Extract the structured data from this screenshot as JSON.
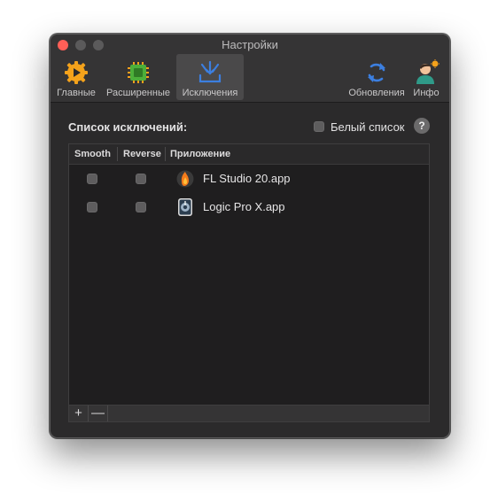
{
  "window": {
    "title": "Настройки"
  },
  "toolbar": {
    "tabs": [
      {
        "label": "Главные",
        "icon": "gear-play-icon"
      },
      {
        "label": "Расширенные",
        "icon": "chip-icon"
      },
      {
        "label": "Исключения",
        "icon": "arrows-in-tray-icon",
        "active": true
      },
      {
        "label": "Обновления",
        "icon": "refresh-icon"
      },
      {
        "label": "Инфо",
        "icon": "person-icon"
      }
    ]
  },
  "exclusions": {
    "section_label": "Список исключений:",
    "whitelist_label": "Белый список",
    "whitelist_checked": false,
    "help_label": "?",
    "columns": [
      "Smooth",
      "Reverse",
      "Приложение"
    ],
    "rows": [
      {
        "smooth": false,
        "reverse": false,
        "app": "FL Studio 20.app",
        "icon": "fl-studio-icon"
      },
      {
        "smooth": false,
        "reverse": false,
        "app": "Logic Pro X.app",
        "icon": "logic-pro-icon"
      }
    ],
    "add_label": "+",
    "remove_label": "—"
  },
  "colors": {
    "accent_orange": "#f4a21b",
    "accent_blue": "#3c7fe0",
    "accent_green": "#4caf3a"
  }
}
